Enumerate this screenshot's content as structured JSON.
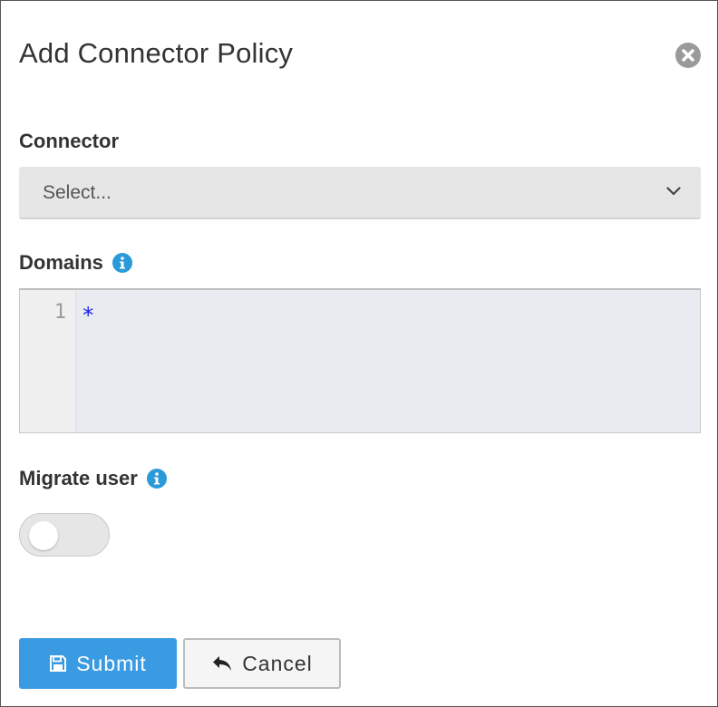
{
  "dialog": {
    "title": "Add Connector Policy",
    "close_icon": "close-circle-icon"
  },
  "connector": {
    "label": "Connector",
    "placeholder": "Select...",
    "icon": "chevron-down-icon"
  },
  "domains": {
    "label": "Domains",
    "info_icon": "info-icon",
    "editor": {
      "line_numbers": [
        "1"
      ],
      "lines": [
        "*"
      ]
    }
  },
  "migrate_user": {
    "label": "Migrate user",
    "info_icon": "info-icon",
    "enabled": false
  },
  "buttons": {
    "submit_label": "Submit",
    "submit_icon": "save-icon",
    "cancel_label": "Cancel",
    "cancel_icon": "undo-icon"
  },
  "colors": {
    "primary": "#3a9be2",
    "info": "#2a9ad8",
    "code_text": "#1a1aee"
  }
}
